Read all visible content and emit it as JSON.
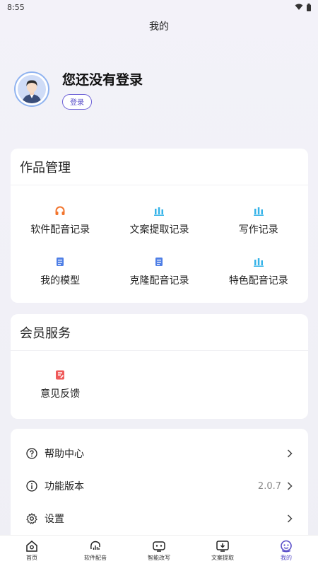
{
  "status_bar": {
    "time": "8:55"
  },
  "header": {
    "title": "我的"
  },
  "profile": {
    "login_title": "您还没有登录",
    "login_button": "登录"
  },
  "works": {
    "title": "作品管理",
    "items": [
      {
        "label": "软件配音记录",
        "icon": "headphones-icon",
        "color": "#f2742c"
      },
      {
        "label": "文案提取记录",
        "icon": "bars-icon",
        "color": "#35b3e8"
      },
      {
        "label": "写作记录",
        "icon": "bars-icon",
        "color": "#35b3e8"
      },
      {
        "label": "我的模型",
        "icon": "document-icon",
        "color": "#4f7fe6"
      },
      {
        "label": "克隆配音记录",
        "icon": "document-icon",
        "color": "#4f7fe6"
      },
      {
        "label": "特色配音记录",
        "icon": "bars-icon",
        "color": "#35b3e8"
      }
    ]
  },
  "member": {
    "title": "会员服务",
    "items": [
      {
        "label": "意见反馈",
        "icon": "feedback-icon",
        "color": "#ef5a5a"
      }
    ]
  },
  "settings": {
    "items": [
      {
        "label": "帮助中心",
        "icon": "help-icon",
        "value": ""
      },
      {
        "label": "功能版本",
        "icon": "info-icon",
        "value": "2.0.7"
      },
      {
        "label": "设置",
        "icon": "gear-icon",
        "value": ""
      }
    ]
  },
  "bottom_nav": {
    "items": [
      {
        "label": "首页",
        "icon": "home-icon"
      },
      {
        "label": "软件配音",
        "icon": "voice-icon"
      },
      {
        "label": "智能改写",
        "icon": "robot-icon"
      },
      {
        "label": "文案提取",
        "icon": "download-icon"
      },
      {
        "label": "我的",
        "icon": "profile-icon"
      }
    ],
    "active_color": "#5a4fc9"
  }
}
